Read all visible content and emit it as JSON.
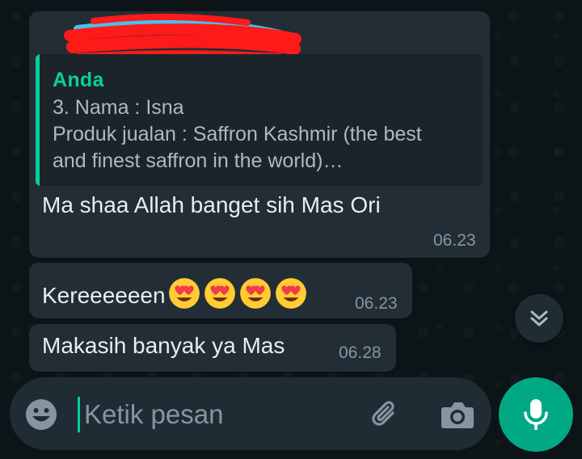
{
  "chat": {
    "messages": [
      {
        "quote": {
          "author": "Anda",
          "lines": [
            "3. Nama : Isna",
            "Produk jualan : Saffron Kashmir (the best",
            "and finest saffron in the world)…"
          ]
        },
        "text": "Ma shaa Allah banget sih Mas Ori",
        "time": "06.23"
      },
      {
        "text": "Kereeeeeen",
        "emoji": "smiling-face-with-heart-eyes",
        "emoji_count": 4,
        "time": "06.23"
      },
      {
        "text": "Makasih banyak ya Mas",
        "time": "06.28"
      }
    ]
  },
  "composer": {
    "placeholder": "Ketik pesan"
  },
  "colors": {
    "background": "#0d1418",
    "bubble": "#232d36",
    "quote_bg": "#1b2429",
    "accent": "#06cf9c",
    "mic_button": "#00a884",
    "text": "#e9edef",
    "muted": "#8696a0",
    "redaction": "#ff1a1a"
  },
  "icons": {
    "scroll": "double-chevron-down-icon",
    "emoji": "emoji-icon",
    "attach": "paperclip-icon",
    "camera": "camera-icon",
    "mic": "microphone-icon"
  }
}
